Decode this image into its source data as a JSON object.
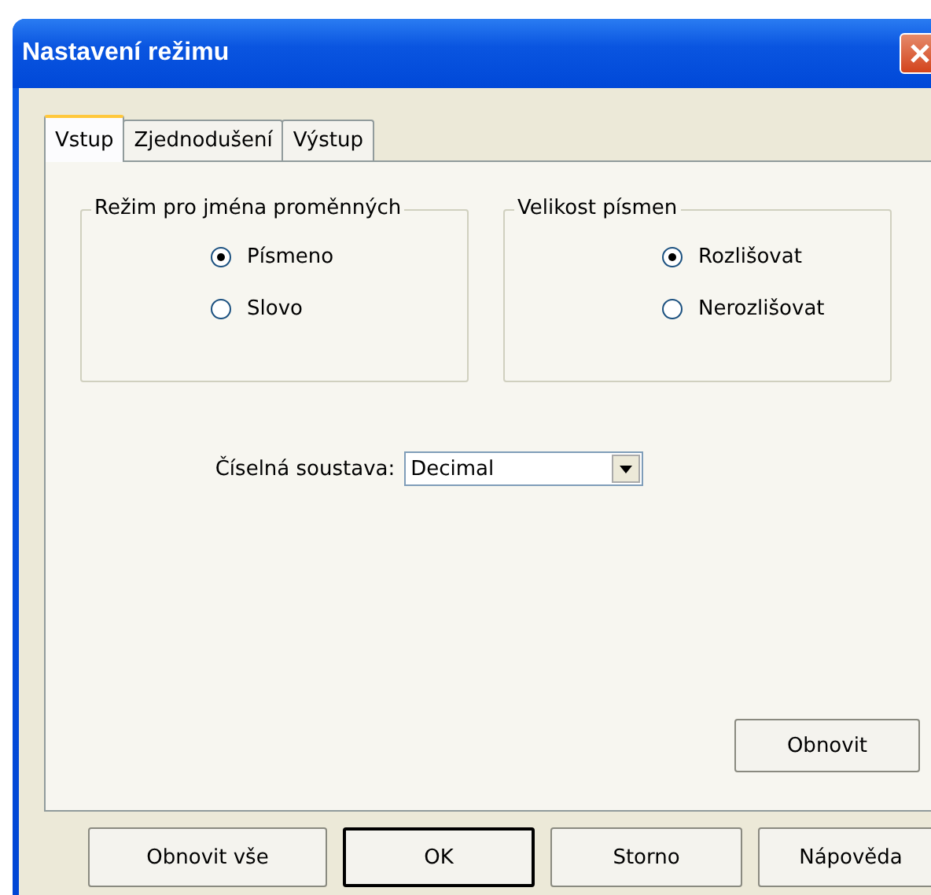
{
  "window": {
    "title": "Nastavení režimu"
  },
  "tabs": [
    {
      "label": "Vstup",
      "selected": true
    },
    {
      "label": "Zjednodušení",
      "selected": false
    },
    {
      "label": "Výstup",
      "selected": false
    }
  ],
  "groups": [
    {
      "title": "Režim pro jména proměnných",
      "options": [
        {
          "label": "Písmeno",
          "selected": true
        },
        {
          "label": "Slovo",
          "selected": false
        }
      ]
    },
    {
      "title": "Velikost písmen",
      "options": [
        {
          "label": "Rozlišovat",
          "selected": true
        },
        {
          "label": "Nerozlišovat",
          "selected": false
        }
      ]
    }
  ],
  "number_system": {
    "label": "Číselná soustava:",
    "value": "Decimal"
  },
  "reset_button": "Obnovit",
  "buttons": [
    {
      "label": "Obnovit vše",
      "default": false
    },
    {
      "label": "OK",
      "default": true
    },
    {
      "label": "Storno",
      "default": false
    },
    {
      "label": "Nápověda",
      "default": false
    }
  ]
}
